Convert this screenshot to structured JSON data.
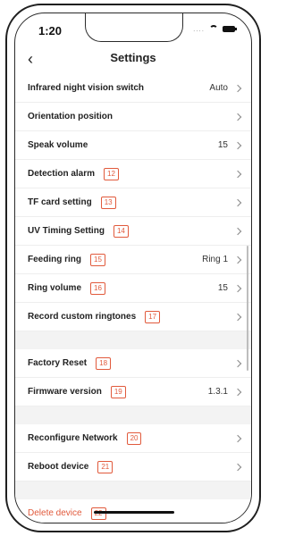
{
  "status": {
    "time": "1:20",
    "signal": "....",
    "wifi_icon": "wifi-icon",
    "battery_icon": "battery-icon"
  },
  "nav": {
    "back_icon": "chevron-left-icon",
    "title": "Settings"
  },
  "rows": [
    {
      "label": "Infrared night vision switch",
      "value": "Auto",
      "num": ""
    },
    {
      "label": "Orientation position",
      "value": "",
      "num": ""
    },
    {
      "label": "Speak volume",
      "value": "15",
      "num": ""
    },
    {
      "label": "Detection alarm",
      "value": "",
      "num": "12"
    },
    {
      "label": "TF card setting",
      "value": "",
      "num": "13"
    },
    {
      "label": "UV Timing Setting",
      "value": "",
      "num": "14"
    },
    {
      "label": "Feeding ring",
      "value": "Ring 1",
      "num": "15"
    },
    {
      "label": "Ring volume",
      "value": "15",
      "num": "16"
    },
    {
      "label": "Record custom ringtones",
      "value": "",
      "num": "17"
    },
    {
      "label": "Factory Reset",
      "value": "",
      "num": "18"
    },
    {
      "label": "Firmware version",
      "value": "1.3.1",
      "num": "19"
    },
    {
      "label": "Reconfigure Network",
      "value": "",
      "num": "20"
    },
    {
      "label": "Reboot device",
      "value": "",
      "num": "21"
    },
    {
      "label": "Delete device",
      "value": "",
      "num": "22"
    }
  ],
  "colors": {
    "accent": "#e15a3c",
    "section_bg": "#f3f3f3"
  }
}
